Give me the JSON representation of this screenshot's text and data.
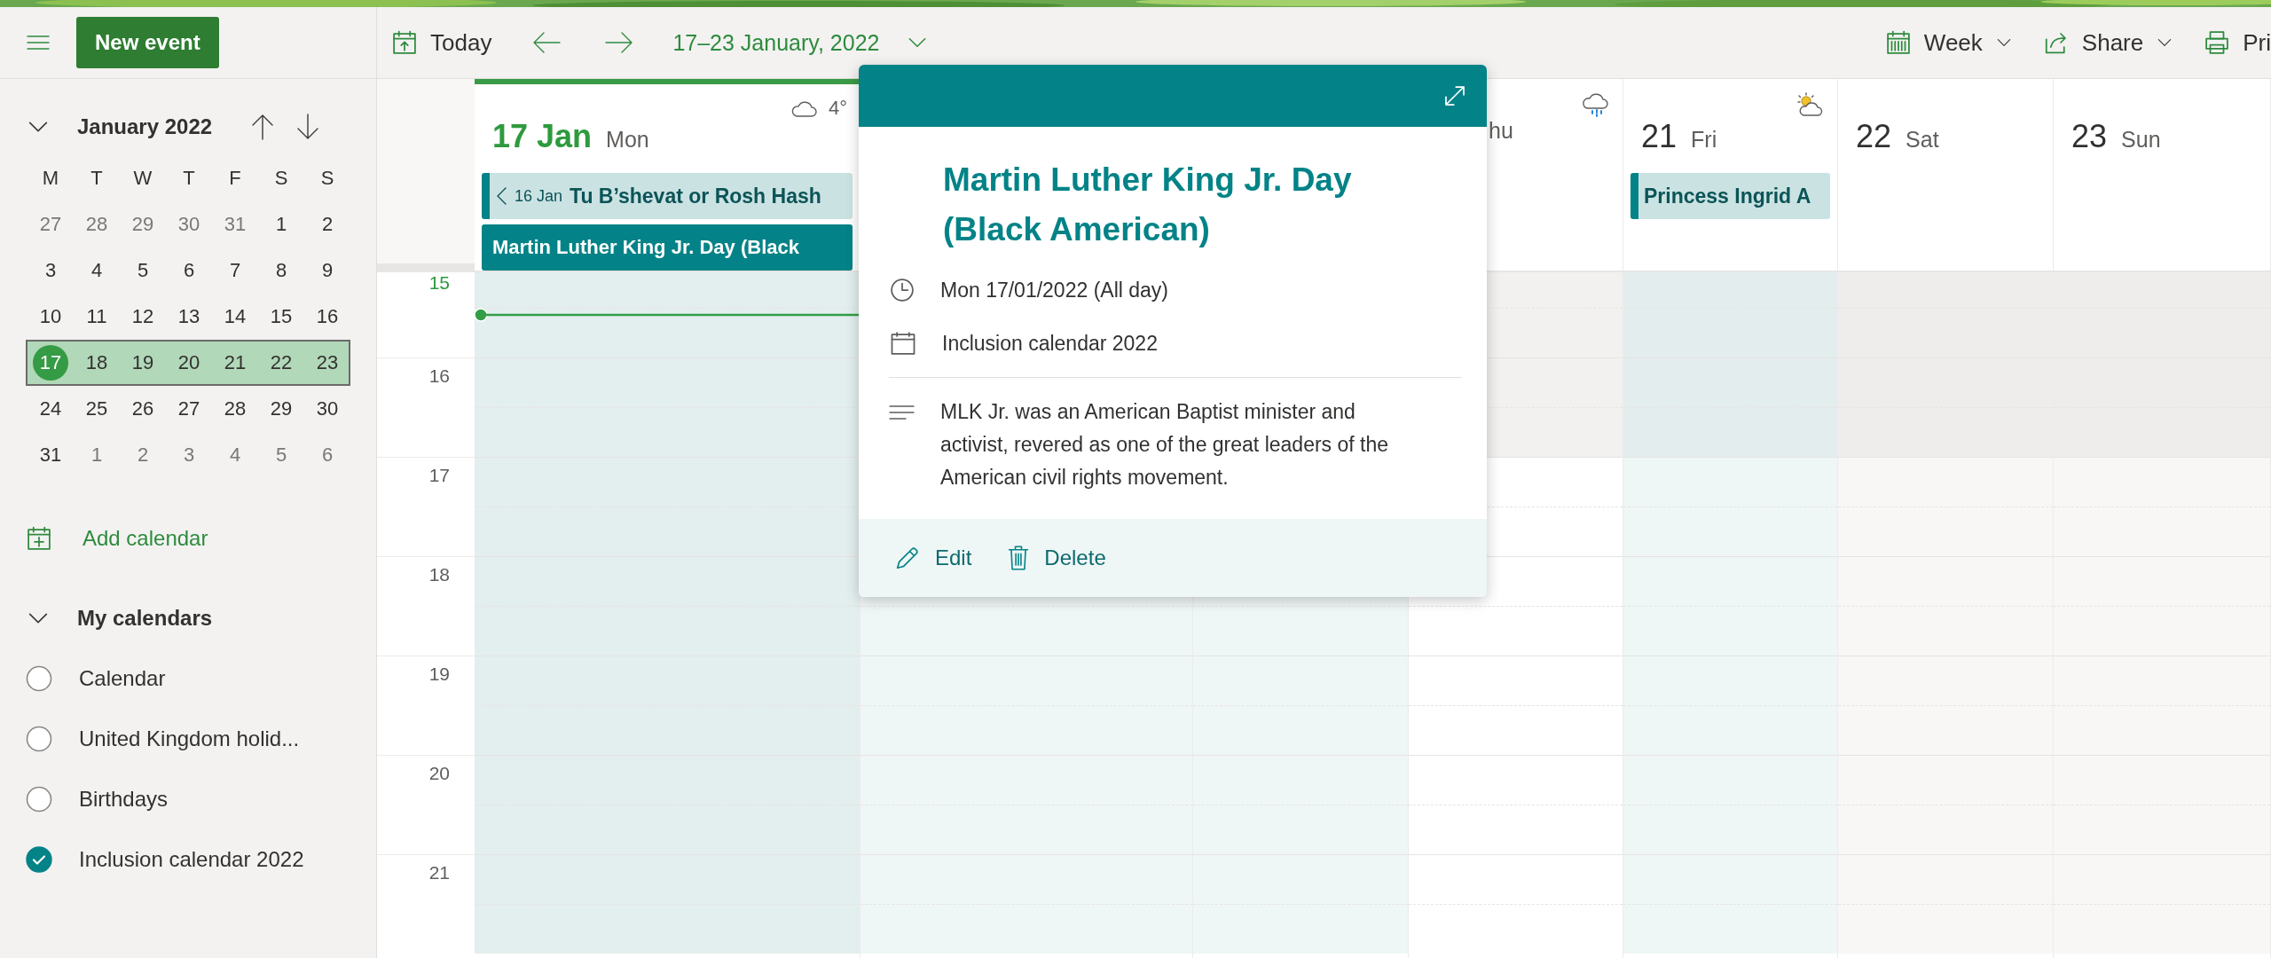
{
  "top_bar": {
    "new_event": "New event",
    "today": "Today",
    "range": "17–23 January, 2022",
    "view": "Week",
    "share": "Share",
    "print": "Pri"
  },
  "mini_calendar": {
    "title": "January 2022",
    "weekdays": [
      "M",
      "T",
      "W",
      "T",
      "F",
      "S",
      "S"
    ],
    "weeks": [
      {
        "selected": false,
        "days": [
          {
            "day": "27",
            "outside": true,
            "today": false
          },
          {
            "day": "28",
            "outside": true,
            "today": false
          },
          {
            "day": "29",
            "outside": true,
            "today": false
          },
          {
            "day": "30",
            "outside": true,
            "today": false
          },
          {
            "day": "31",
            "outside": true,
            "today": false
          },
          {
            "day": "1",
            "outside": false,
            "today": false
          },
          {
            "day": "2",
            "outside": false,
            "today": false
          }
        ]
      },
      {
        "selected": false,
        "days": [
          {
            "day": "3",
            "outside": false,
            "today": false
          },
          {
            "day": "4",
            "outside": false,
            "today": false
          },
          {
            "day": "5",
            "outside": false,
            "today": false
          },
          {
            "day": "6",
            "outside": false,
            "today": false
          },
          {
            "day": "7",
            "outside": false,
            "today": false
          },
          {
            "day": "8",
            "outside": false,
            "today": false
          },
          {
            "day": "9",
            "outside": false,
            "today": false
          }
        ]
      },
      {
        "selected": false,
        "days": [
          {
            "day": "10",
            "outside": false,
            "today": false
          },
          {
            "day": "11",
            "outside": false,
            "today": false
          },
          {
            "day": "12",
            "outside": false,
            "today": false
          },
          {
            "day": "13",
            "outside": false,
            "today": false
          },
          {
            "day": "14",
            "outside": false,
            "today": false
          },
          {
            "day": "15",
            "outside": false,
            "today": false
          },
          {
            "day": "16",
            "outside": false,
            "today": false
          }
        ]
      },
      {
        "selected": true,
        "days": [
          {
            "day": "17",
            "outside": false,
            "today": true
          },
          {
            "day": "18",
            "outside": false,
            "today": false
          },
          {
            "day": "19",
            "outside": false,
            "today": false
          },
          {
            "day": "20",
            "outside": false,
            "today": false
          },
          {
            "day": "21",
            "outside": false,
            "today": false
          },
          {
            "day": "22",
            "outside": false,
            "today": false
          },
          {
            "day": "23",
            "outside": false,
            "today": false
          }
        ]
      },
      {
        "selected": false,
        "days": [
          {
            "day": "24",
            "outside": false,
            "today": false
          },
          {
            "day": "25",
            "outside": false,
            "today": false
          },
          {
            "day": "26",
            "outside": false,
            "today": false
          },
          {
            "day": "27",
            "outside": false,
            "today": false
          },
          {
            "day": "28",
            "outside": false,
            "today": false
          },
          {
            "day": "29",
            "outside": false,
            "today": false
          },
          {
            "day": "30",
            "outside": false,
            "today": false
          }
        ]
      },
      {
        "selected": false,
        "days": [
          {
            "day": "31",
            "outside": false,
            "today": false
          },
          {
            "day": "1",
            "outside": true,
            "today": false
          },
          {
            "day": "2",
            "outside": true,
            "today": false
          },
          {
            "day": "3",
            "outside": true,
            "today": false
          },
          {
            "day": "4",
            "outside": true,
            "today": false
          },
          {
            "day": "5",
            "outside": true,
            "today": false
          },
          {
            "day": "6",
            "outside": true,
            "today": false
          }
        ]
      }
    ]
  },
  "add_calendar": "Add calendar",
  "my_calendars": {
    "title": "My calendars",
    "expanded": true,
    "items": [
      {
        "name": "Calendar",
        "checked": false
      },
      {
        "name": "United Kingdom holid...",
        "checked": false
      },
      {
        "name": "Birthdays",
        "checked": false
      },
      {
        "name": "Inclusion calendar 2022",
        "checked": true
      }
    ]
  },
  "week": {
    "hours": [
      {
        "label": "15",
        "working": false
      },
      {
        "label": "16",
        "working": false
      },
      {
        "label": "17",
        "working": true
      },
      {
        "label": "18",
        "working": true
      },
      {
        "label": "19",
        "working": true
      },
      {
        "label": "20",
        "working": true
      },
      {
        "label": "21",
        "working": true
      }
    ],
    "days": [
      {
        "number": "17 Jan",
        "weekday": "Mon",
        "kind": "today",
        "weather": {
          "kind": "cloudy",
          "temperature": "4°"
        },
        "events": [
          {
            "title": "Tu B’shevat or Rosh Hash",
            "from": "16 Jan",
            "continued": true,
            "selected": false
          },
          {
            "title": "Martin Luther King Jr. Day (Black",
            "continued": false,
            "selected": true
          }
        ]
      },
      {
        "kind": "tinted"
      },
      {
        "kind": "tinted"
      },
      {
        "weekday": "hu",
        "kind": "plain",
        "weather": {
          "kind": "rain"
        }
      },
      {
        "number": "21",
        "weekday": "Fri",
        "kind": "tinted",
        "weather": {
          "kind": "sun-cloud"
        },
        "events": [
          {
            "title": "Princess Ingrid A",
            "continued": false,
            "selected": false
          }
        ]
      },
      {
        "number": "22",
        "weekday": "Sat",
        "kind": "weekend"
      },
      {
        "number": "23",
        "weekday": "Sun",
        "kind": "weekend"
      }
    ]
  },
  "popup": {
    "title": "Martin Luther King Jr. Day (Black American)",
    "when": "Mon 17/01/2022 (All day)",
    "calendar": "Inclusion calendar 2022",
    "description": "MLK Jr. was an American Baptist minister and activist, revered as one of the great leaders of the American civil rights movement.",
    "actions": [
      {
        "label": "Edit",
        "kind": "edit"
      },
      {
        "label": "Delete",
        "kind": "delete"
      }
    ]
  }
}
